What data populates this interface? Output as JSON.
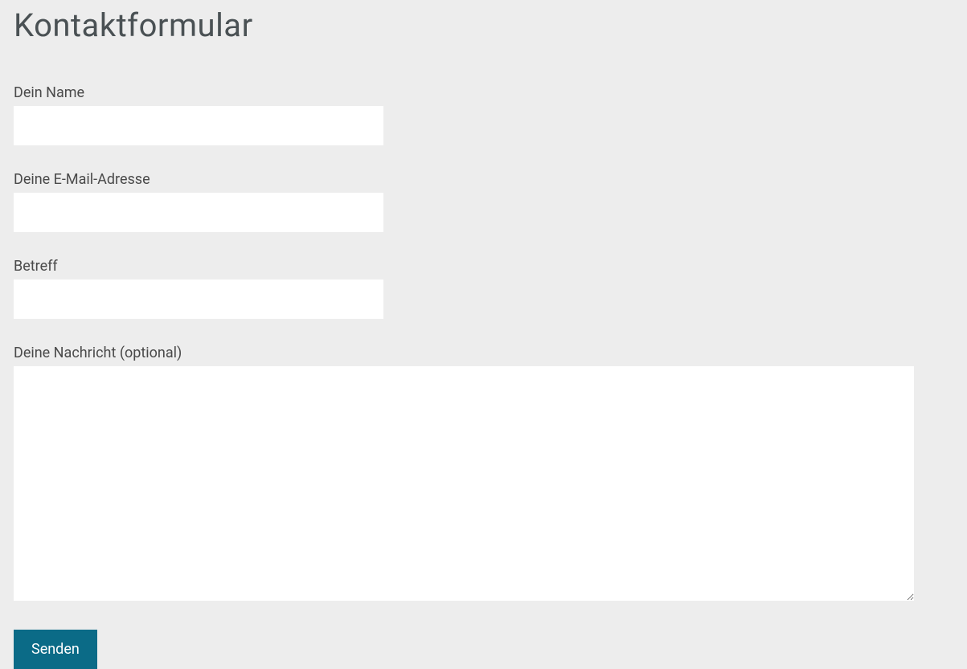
{
  "page": {
    "title": "Kontaktformular"
  },
  "form": {
    "name": {
      "label": "Dein Name",
      "value": ""
    },
    "email": {
      "label": "Deine E-Mail-Adresse",
      "value": ""
    },
    "subject": {
      "label": "Betreff",
      "value": ""
    },
    "message": {
      "label": "Deine Nachricht (optional)",
      "value": ""
    },
    "submit": {
      "label": "Senden"
    }
  }
}
